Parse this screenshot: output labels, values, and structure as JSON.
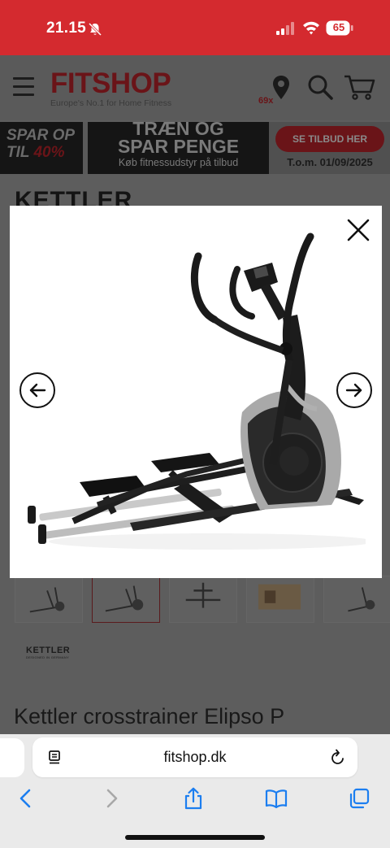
{
  "status_bar": {
    "time": "21.15",
    "battery": "65"
  },
  "header": {
    "logo": "FITSHOP",
    "tagline": "Europe's No.1 for Home Fitness",
    "store_count": "69x",
    "icons": [
      "menu-icon",
      "location-pin-icon",
      "search-icon",
      "cart-icon"
    ]
  },
  "promo": {
    "left_line1": "SPAR OP",
    "left_line2a": "TIL",
    "left_line2b": "40%",
    "headline1": "TRÆN OG",
    "headline2": "SPAR PENGE",
    "subline": "Køb fitnessudstyr på tilbud",
    "button": "SE TILBUD HER",
    "date": "T.o.m. 01/09/2025"
  },
  "product": {
    "brand_heading": "KETTLER",
    "brand_logo": "KETTLER",
    "brand_logo_sub": "DESIGNED IN GERMANY",
    "title": "Kettler crosstrainer Elipso P"
  },
  "modal": {
    "icons": [
      "close-icon",
      "arrow-left-icon",
      "arrow-right-icon"
    ]
  },
  "browser": {
    "url": "fitshop.dk",
    "icons": [
      "reader-icon",
      "reload-icon",
      "back-icon",
      "forward-icon",
      "share-icon",
      "bookmarks-icon",
      "tabs-icon"
    ]
  },
  "colors": {
    "brand_red": "#d42a2f",
    "overlay": "#5c5c5c"
  }
}
